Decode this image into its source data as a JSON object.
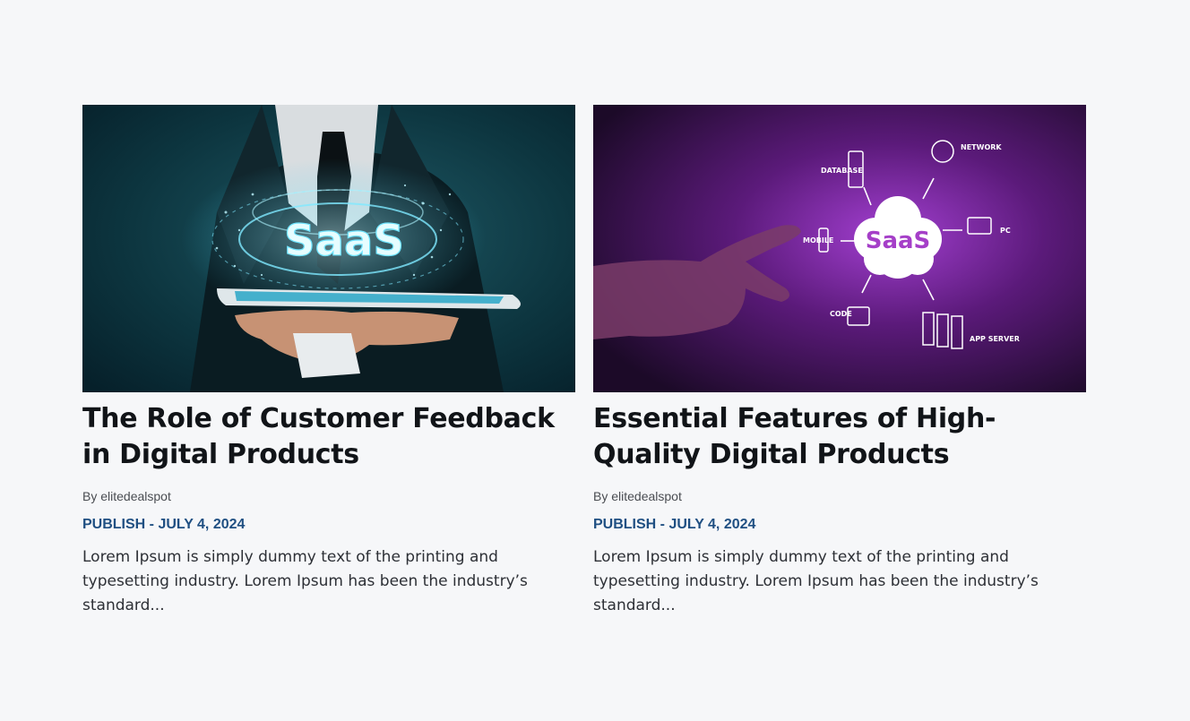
{
  "posts": [
    {
      "image_label": "SaaS",
      "title": "The Role of Customer Feedback in Digital Products",
      "author": "By elitedealspot",
      "date": "PUBLISH - JULY 4, 2024",
      "excerpt": "Lorem Ipsum is simply dummy text of the printing and typesetting industry. Lorem Ipsum has been the industry’s standard..."
    },
    {
      "image_label": "SaaS",
      "image_nodes": {
        "network": "NETWORK",
        "database": "DATABASE",
        "pc": "PC",
        "mobile": "MOBILE",
        "code": "CODE",
        "app_server": "APP SERVER"
      },
      "title": "Essential Features of High-Quality Digital Products",
      "author": "By elitedealspot",
      "date": "PUBLISH - JULY 4, 2024",
      "excerpt": "Lorem Ipsum is simply dummy text of the printing and typesetting industry. Lorem Ipsum has been the industry’s standard..."
    }
  ],
  "colors": {
    "background": "#f6f7f9",
    "title": "#111418",
    "date": "#1f4f82",
    "card1_bg": "#0e3a44",
    "card2_bg": "#5b1a7a"
  }
}
